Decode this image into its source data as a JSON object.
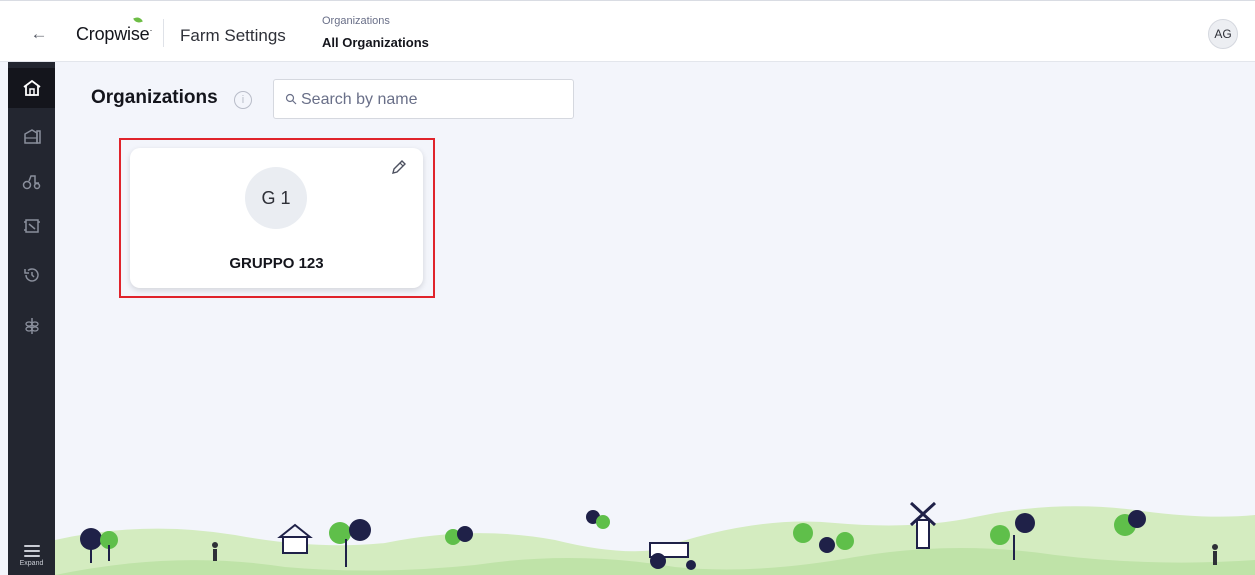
{
  "header": {
    "back_icon": "arrow-left-icon",
    "brand": "Cropwise",
    "app_title": "Farm Settings",
    "breadcrumb_label": "Organizations",
    "breadcrumb_value": "All Organizations",
    "user_initials": "AG"
  },
  "sidebar": {
    "items": [
      {
        "icon": "home-icon",
        "active": true
      },
      {
        "icon": "farm-icon",
        "active": false
      },
      {
        "icon": "tractor-icon",
        "active": false
      },
      {
        "icon": "field-icon",
        "active": false
      },
      {
        "icon": "history-icon",
        "active": false
      },
      {
        "icon": "crop-icon",
        "active": false
      }
    ],
    "expand_label": "Expand"
  },
  "main": {
    "title": "Organizations",
    "search_placeholder": "Search by name",
    "organizations": [
      {
        "initials": "G 1",
        "name": "GRUPPO 123"
      }
    ]
  },
  "colors": {
    "sidebar_bg": "#232630",
    "page_bg": "#f3f5fb",
    "highlight": "#e0232b",
    "hill_green": "#d4ecc0",
    "tree_green": "#5fbf4a",
    "tree_dark": "#1f2148"
  }
}
